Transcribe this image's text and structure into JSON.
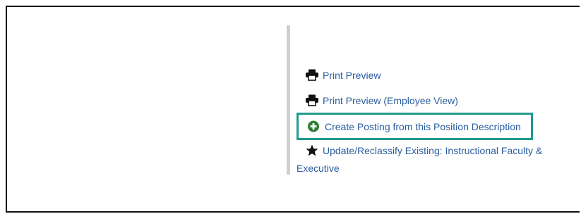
{
  "actions": {
    "print_preview": "Print Preview",
    "print_preview_employee": "Print Preview (Employee View)",
    "create_posting": "Create Posting from this Position Description",
    "update_reclassify": "Update/Reclassify Existing: Instructional Faculty & Executive"
  },
  "icons": {
    "print_preview": "printer-icon",
    "print_preview_employee": "printer-icon",
    "create_posting": "plus-circle-icon",
    "update_reclassify": "star-icon"
  },
  "colors": {
    "link": "#2a5d9f",
    "highlight_border": "#1f9a8e",
    "plus_icon": "#2e7d32",
    "divider": "#cfcfcf"
  }
}
